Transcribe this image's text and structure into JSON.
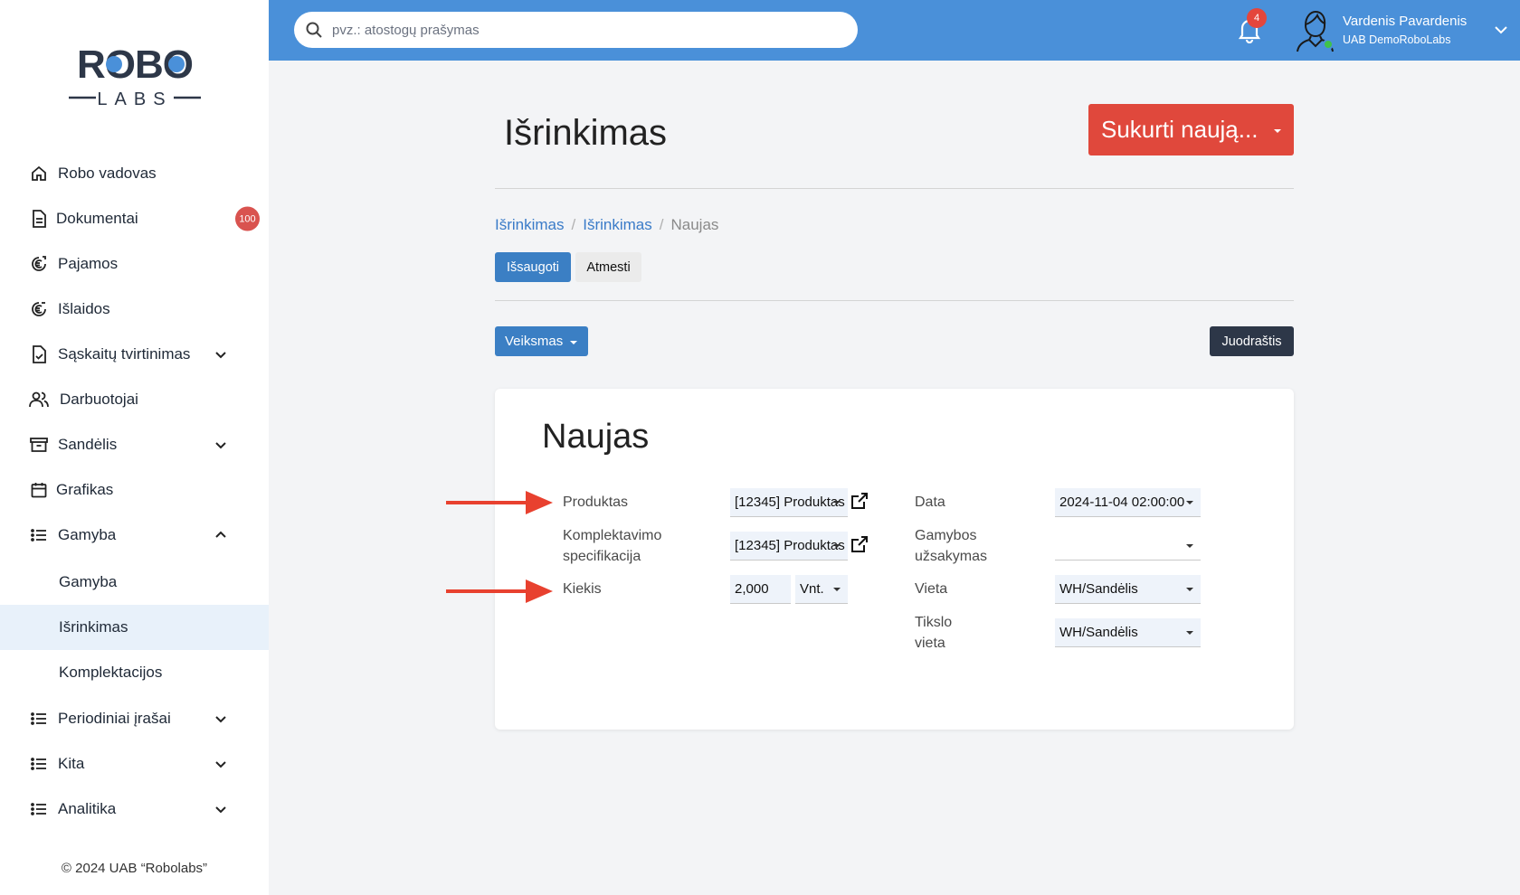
{
  "sidebar": {
    "logo_top": "ROBO",
    "logo_bottom": "LABS",
    "items": [
      {
        "label": "Robo vadovas",
        "icon": "home-icon"
      },
      {
        "label": "Dokumentai",
        "icon": "document-icon",
        "badge": "100"
      },
      {
        "label": "Pajamos",
        "icon": "euro-income-icon"
      },
      {
        "label": "Išlaidos",
        "icon": "euro-expense-icon"
      },
      {
        "label": "Sąskaitų tvirtinimas",
        "icon": "invoice-check-icon",
        "expandable": true
      },
      {
        "label": "Darbuotojai",
        "icon": "users-icon"
      },
      {
        "label": "Sandėlis",
        "icon": "archive-box-icon",
        "expandable": true
      },
      {
        "label": "Grafikas",
        "icon": "calendar-icon"
      },
      {
        "label": "Gamyba",
        "icon": "list-icon",
        "expanded": true
      },
      {
        "label": "Gamyba",
        "sub": true
      },
      {
        "label": "Išrinkimas",
        "sub": true,
        "active": true
      },
      {
        "label": "Komplektacijos",
        "sub": true
      },
      {
        "label": "Periodiniai įrašai",
        "icon": "list-icon",
        "expandable": true
      },
      {
        "label": "Kita",
        "icon": "list-icon",
        "expandable": true
      },
      {
        "label": "Analitika",
        "icon": "list-icon",
        "expandable": true
      }
    ],
    "copyright": "© 2024 UAB “Robolabs”"
  },
  "topbar": {
    "search_placeholder": "pvz.: atostogų prašymas",
    "notification_count": "4",
    "user_name": "Vardenis Pavardenis",
    "user_company": "UAB DemoRoboLabs"
  },
  "main": {
    "title": "Išrinkimas",
    "create_button": "Sukurti naują...",
    "breadcrumb": [
      "Išrinkimas",
      "Išrinkimas",
      "Naujas"
    ],
    "save_button": "Išsaugoti",
    "discard_button": "Atmesti",
    "action_button": "Veiksmas",
    "draft_button": "Juodraštis"
  },
  "form": {
    "title": "Naujas",
    "product_label": "Produktas",
    "product_value": "[12345] Produktas",
    "bom_label_1": "Komplektavimo",
    "bom_label_2": "specifikacija",
    "bom_value": "[12345] Produktas",
    "qty_label": "Kiekis",
    "qty_value": "2,000",
    "uom_value": "Vnt.",
    "date_label": "Data",
    "date_value": "2024-11-04 02:00:00",
    "order_label_1": "Gamybos",
    "order_label_2": "užsakymas",
    "order_value": "",
    "location_label": "Vieta",
    "location_value": "WH/Sandėlis",
    "dest_label_1": "Tikslo",
    "dest_label_2": "vieta",
    "dest_value": "WH/Sandėlis"
  },
  "colors": {
    "topbar": "#4a90d9",
    "primary": "#3b7fc4",
    "create": "#e0483c",
    "annotation_arrow": "#e8412f",
    "badge": "#d9534f"
  }
}
